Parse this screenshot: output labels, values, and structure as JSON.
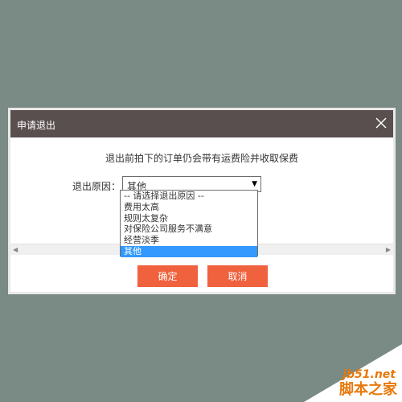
{
  "dialog": {
    "title": "申请退出",
    "notice": "退出前拍下的订单仍会带有运费险并收取保费",
    "reason_label": "退出原因：",
    "selected_value": "其他",
    "options": [
      "-- 请选择退出原因 --",
      "费用太高",
      "规则太复杂",
      "对保险公司服务不满意",
      "经营淡季",
      "其他"
    ],
    "selected_index": 5,
    "confirm_label": "确定",
    "cancel_label": "取消"
  },
  "watermark": {
    "site": "jb51.net",
    "name": "脚本之家"
  },
  "colors": {
    "background": "#7a8a84",
    "titlebar": "#5a4f4f",
    "button": "#f0613e",
    "selected_option": "#3399ff",
    "watermark": "#e8780a"
  }
}
